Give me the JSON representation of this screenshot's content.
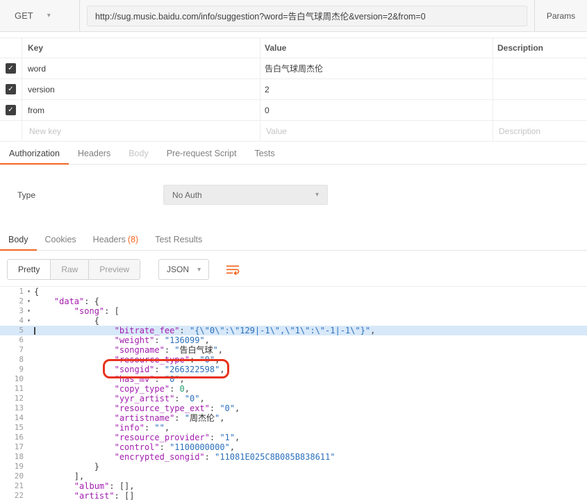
{
  "colors": {
    "accent": "#f26722",
    "annotation_red": "#e8321e",
    "highlight_blue": "#d7e8f9",
    "key": "#a21caf",
    "str": "#2a6fbb",
    "num": "#1f9d6b"
  },
  "request": {
    "method": "GET",
    "url": "http://sug.music.baidu.com/info/suggestion?word=告白气球周杰伦&version=2&from=0",
    "params_label": "Params"
  },
  "params_table": {
    "columns": {
      "key": "Key",
      "value": "Value",
      "description": "Description"
    },
    "rows": [
      {
        "checked": true,
        "key": "word",
        "value": "告白气球周杰伦",
        "description": ""
      },
      {
        "checked": true,
        "key": "version",
        "value": "2",
        "description": ""
      },
      {
        "checked": true,
        "key": "from",
        "value": "0",
        "description": ""
      }
    ],
    "new_row": {
      "key_placeholder": "New key",
      "value_placeholder": "Value",
      "description_placeholder": "Description"
    }
  },
  "request_tabs": [
    {
      "label": "Authorization",
      "state": "active"
    },
    {
      "label": "Headers",
      "state": "normal"
    },
    {
      "label": "Body",
      "state": "disabled"
    },
    {
      "label": "Pre-request Script",
      "state": "normal"
    },
    {
      "label": "Tests",
      "state": "normal"
    }
  ],
  "auth": {
    "type_label": "Type",
    "type_value": "No Auth"
  },
  "response_tabs": [
    {
      "label": "Body",
      "state": "active"
    },
    {
      "label": "Cookies",
      "state": "normal"
    },
    {
      "label": "Headers",
      "count": "(8)",
      "state": "normal"
    },
    {
      "label": "Test Results",
      "state": "normal"
    }
  ],
  "viewer": {
    "modes": [
      "Pretty",
      "Raw",
      "Preview"
    ],
    "active_mode": "Pretty",
    "format": "JSON"
  },
  "code": {
    "lines": [
      {
        "n": 1,
        "fold": true,
        "tokens": [
          [
            "p",
            "{"
          ]
        ]
      },
      {
        "n": 2,
        "fold": true,
        "tokens": [
          [
            "p",
            "    "
          ],
          [
            "k",
            "\"data\""
          ],
          [
            "p",
            ": {"
          ]
        ]
      },
      {
        "n": 3,
        "fold": true,
        "tokens": [
          [
            "p",
            "        "
          ],
          [
            "k",
            "\"song\""
          ],
          [
            "p",
            ": ["
          ]
        ]
      },
      {
        "n": 4,
        "fold": true,
        "tokens": [
          [
            "p",
            "            {"
          ]
        ]
      },
      {
        "n": 5,
        "hl": true,
        "caret": true,
        "tokens": [
          [
            "p",
            "                "
          ],
          [
            "k",
            "\"bitrate_fee\""
          ],
          [
            "p",
            ": "
          ],
          [
            "s",
            "\"{\\\"0\\\":\\\"129|-1\\\",\\\"1\\\":\\\"-1|-1\\\"}\""
          ],
          [
            "p",
            ","
          ]
        ]
      },
      {
        "n": 6,
        "tokens": [
          [
            "p",
            "                "
          ],
          [
            "k",
            "\"weight\""
          ],
          [
            "p",
            ": "
          ],
          [
            "s",
            "\"136099\""
          ],
          [
            "p",
            ","
          ]
        ]
      },
      {
        "n": 7,
        "tokens": [
          [
            "p",
            "                "
          ],
          [
            "k",
            "\"songname\""
          ],
          [
            "p",
            ": "
          ],
          [
            "s",
            "\""
          ],
          [
            "c",
            "告白气球"
          ],
          [
            "s",
            "\""
          ],
          [
            "p",
            ","
          ]
        ]
      },
      {
        "n": 8,
        "tokens": [
          [
            "p",
            "                "
          ],
          [
            "k",
            "\"resource_type\""
          ],
          [
            "p",
            ": "
          ],
          [
            "s",
            "\"0\""
          ],
          [
            "p",
            ","
          ]
        ]
      },
      {
        "n": 9,
        "tokens": [
          [
            "p",
            "                "
          ],
          [
            "k",
            "\"songid\""
          ],
          [
            "p",
            ": "
          ],
          [
            "s",
            "\"266322598\""
          ],
          [
            "p",
            ","
          ]
        ]
      },
      {
        "n": 10,
        "tokens": [
          [
            "p",
            "                "
          ],
          [
            "k",
            "\"has_mv\""
          ],
          [
            "p",
            ": "
          ],
          [
            "s",
            "\"0\""
          ],
          [
            "p",
            ","
          ]
        ]
      },
      {
        "n": 11,
        "tokens": [
          [
            "p",
            "                "
          ],
          [
            "k",
            "\"copy_type\""
          ],
          [
            "p",
            ": "
          ],
          [
            "n",
            "0"
          ],
          [
            "p",
            ","
          ]
        ]
      },
      {
        "n": 12,
        "tokens": [
          [
            "p",
            "                "
          ],
          [
            "k",
            "\"yyr_artist\""
          ],
          [
            "p",
            ": "
          ],
          [
            "s",
            "\"0\""
          ],
          [
            "p",
            ","
          ]
        ]
      },
      {
        "n": 13,
        "tokens": [
          [
            "p",
            "                "
          ],
          [
            "k",
            "\"resource_type_ext\""
          ],
          [
            "p",
            ": "
          ],
          [
            "s",
            "\"0\""
          ],
          [
            "p",
            ","
          ]
        ]
      },
      {
        "n": 14,
        "tokens": [
          [
            "p",
            "                "
          ],
          [
            "k",
            "\"artistname\""
          ],
          [
            "p",
            ": "
          ],
          [
            "s",
            "\""
          ],
          [
            "c",
            "周杰伦"
          ],
          [
            "s",
            "\""
          ],
          [
            "p",
            ","
          ]
        ]
      },
      {
        "n": 15,
        "tokens": [
          [
            "p",
            "                "
          ],
          [
            "k",
            "\"info\""
          ],
          [
            "p",
            ": "
          ],
          [
            "s",
            "\"\""
          ],
          [
            "p",
            ","
          ]
        ]
      },
      {
        "n": 16,
        "tokens": [
          [
            "p",
            "                "
          ],
          [
            "k",
            "\"resource_provider\""
          ],
          [
            "p",
            ": "
          ],
          [
            "s",
            "\"1\""
          ],
          [
            "p",
            ","
          ]
        ]
      },
      {
        "n": 17,
        "tokens": [
          [
            "p",
            "                "
          ],
          [
            "k",
            "\"control\""
          ],
          [
            "p",
            ": "
          ],
          [
            "s",
            "\"1100000000\""
          ],
          [
            "p",
            ","
          ]
        ]
      },
      {
        "n": 18,
        "tokens": [
          [
            "p",
            "                "
          ],
          [
            "k",
            "\"encrypted_songid\""
          ],
          [
            "p",
            ": "
          ],
          [
            "s",
            "\"11081E025C8B085B838611\""
          ]
        ]
      },
      {
        "n": 19,
        "tokens": [
          [
            "p",
            "            }"
          ]
        ]
      },
      {
        "n": 20,
        "tokens": [
          [
            "p",
            "        ],"
          ]
        ]
      },
      {
        "n": 21,
        "tokens": [
          [
            "p",
            "        "
          ],
          [
            "k",
            "\"album\""
          ],
          [
            "p",
            ": [],"
          ]
        ]
      },
      {
        "n": 22,
        "tokens": [
          [
            "p",
            "        "
          ],
          [
            "k",
            "\"artist\""
          ],
          [
            "p",
            ": []"
          ]
        ]
      }
    ]
  }
}
